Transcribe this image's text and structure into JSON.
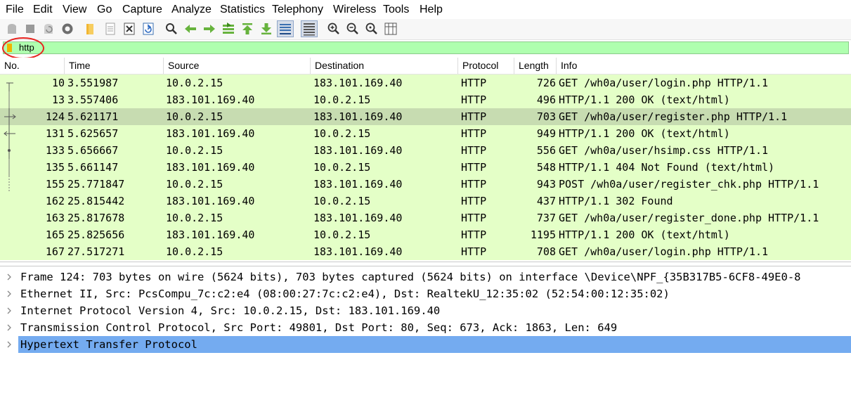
{
  "menu": [
    "File",
    "Edit",
    "View",
    "Go",
    "Capture",
    "Analyze",
    "Statistics",
    "Telephony",
    "Wireless",
    "Tools",
    "Help"
  ],
  "toolbar_icons": [
    "start-capture-icon",
    "stop-capture-icon",
    "restart-capture-icon",
    "capture-options-icon",
    "open-file-icon",
    "save-file-icon",
    "close-file-icon",
    "reload-file-icon",
    "find-packet-icon",
    "go-back-icon",
    "go-forward-icon",
    "go-to-packet-icon",
    "go-first-packet-icon",
    "go-last-packet-icon",
    "auto-scroll-icon",
    "colorize-icon",
    "zoom-in-icon",
    "zoom-out-icon",
    "normal-size-icon",
    "resize-columns-icon"
  ],
  "filter": {
    "value": "http"
  },
  "columns": [
    "No.",
    "Time",
    "Source",
    "Destination",
    "Protocol",
    "Length",
    "Info"
  ],
  "packets": [
    {
      "no": "10",
      "time": "3.551987",
      "src": "10.0.2.15",
      "dst": "183.101.169.40",
      "proto": "HTTP",
      "len": "726",
      "info": "GET /wh0a/user/login.php HTTP/1.1"
    },
    {
      "no": "13",
      "time": "3.557406",
      "src": "183.101.169.40",
      "dst": "10.0.2.15",
      "proto": "HTTP",
      "len": "496",
      "info": "HTTP/1.1 200 OK  (text/html)"
    },
    {
      "no": "124",
      "time": "5.621171",
      "src": "10.0.2.15",
      "dst": "183.101.169.40",
      "proto": "HTTP",
      "len": "703",
      "info": "GET /wh0a/user/register.php HTTP/1.1"
    },
    {
      "no": "131",
      "time": "5.625657",
      "src": "183.101.169.40",
      "dst": "10.0.2.15",
      "proto": "HTTP",
      "len": "949",
      "info": "HTTP/1.1 200 OK  (text/html)"
    },
    {
      "no": "133",
      "time": "5.656667",
      "src": "10.0.2.15",
      "dst": "183.101.169.40",
      "proto": "HTTP",
      "len": "556",
      "info": "GET /wh0a/user/hsimp.css HTTP/1.1"
    },
    {
      "no": "135",
      "time": "5.661147",
      "src": "183.101.169.40",
      "dst": "10.0.2.15",
      "proto": "HTTP",
      "len": "548",
      "info": "HTTP/1.1 404 Not Found  (text/html)"
    },
    {
      "no": "155",
      "time": "25.771847",
      "src": "10.0.2.15",
      "dst": "183.101.169.40",
      "proto": "HTTP",
      "len": "943",
      "info": "POST /wh0a/user/register_chk.php HTTP/1.1"
    },
    {
      "no": "162",
      "time": "25.815442",
      "src": "183.101.169.40",
      "dst": "10.0.2.15",
      "proto": "HTTP",
      "len": "437",
      "info": "HTTP/1.1 302 Found"
    },
    {
      "no": "163",
      "time": "25.817678",
      "src": "10.0.2.15",
      "dst": "183.101.169.40",
      "proto": "HTTP",
      "len": "737",
      "info": "GET /wh0a/user/register_done.php HTTP/1.1"
    },
    {
      "no": "165",
      "time": "25.825656",
      "src": "183.101.169.40",
      "dst": "10.0.2.15",
      "proto": "HTTP",
      "len": "1195",
      "info": "HTTP/1.1 200 OK  (text/html)"
    },
    {
      "no": "167",
      "time": "27.517271",
      "src": "10.0.2.15",
      "dst": "183.101.169.40",
      "proto": "HTTP",
      "len": "708",
      "info": "GET /wh0a/user/login.php HTTP/1.1"
    }
  ],
  "details": [
    "Frame 124: 703 bytes on wire (5624 bits), 703 bytes captured (5624 bits) on interface \\Device\\NPF_{35B317B5-6CF8-49E0-8",
    "Ethernet II, Src: PcsCompu_7c:c2:e4 (08:00:27:7c:c2:e4), Dst: RealtekU_12:35:02 (52:54:00:12:35:02)",
    "Internet Protocol Version 4, Src: 10.0.2.15, Dst: 183.101.169.40",
    "Transmission Control Protocol, Src Port: 49801, Dst Port: 80, Seq: 673, Ack: 1863, Len: 649",
    "Hypertext Transfer Protocol"
  ],
  "colors": {
    "filter_valid": "#afffaf",
    "row_http": "#e4ffc7",
    "row_selected": "#c7dcb1",
    "detail_selected": "#74abf0",
    "annotation": "#e8231f"
  }
}
